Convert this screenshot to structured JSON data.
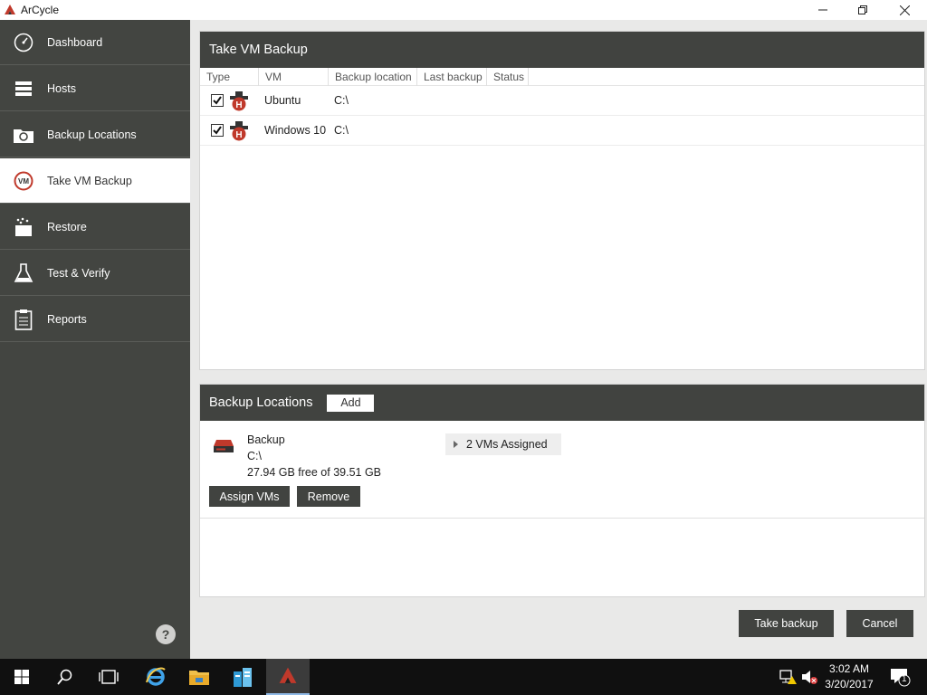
{
  "window": {
    "title": "ArCycle",
    "minimize_icon": "minimize-icon",
    "maximize_icon": "restore-icon",
    "close_icon": "close-icon"
  },
  "sidebar": {
    "items": [
      {
        "label": "Dashboard",
        "icon": "gauge-icon"
      },
      {
        "label": "Hosts",
        "icon": "server-rack-icon"
      },
      {
        "label": "Backup Locations",
        "icon": "backup-folder-icon"
      },
      {
        "label": "Take VM Backup",
        "icon": "vm-icon",
        "active": true
      },
      {
        "label": "Restore",
        "icon": "restore-box-icon"
      },
      {
        "label": "Test & Verify",
        "icon": "flask-icon"
      },
      {
        "label": "Reports",
        "icon": "clipboard-icon"
      }
    ],
    "help_label": "?"
  },
  "vm_panel": {
    "title": "Take VM Backup",
    "columns": [
      "Type",
      "VM",
      "Backup location",
      "Last backup",
      "Status"
    ],
    "rows": [
      {
        "checked": true,
        "type_icon": "hyperv-host-icon",
        "vm": "Ubuntu",
        "backup_location": "C:\\",
        "last_backup": "",
        "status": ""
      },
      {
        "checked": true,
        "type_icon": "hyperv-host-icon",
        "vm": "Windows 10",
        "backup_location": "C:\\",
        "last_backup": "",
        "status": ""
      }
    ]
  },
  "locations_panel": {
    "title": "Backup Locations",
    "add_label": "Add",
    "location": {
      "name": "Backup",
      "path": "C:\\",
      "free_space": "27.94 GB free of 39.51 GB",
      "assigned": "2 VMs Assigned",
      "assign_label": "Assign VMs",
      "remove_label": "Remove"
    }
  },
  "actions": {
    "take_backup": "Take backup",
    "cancel": "Cancel"
  },
  "taskbar": {
    "time": "3:02 AM",
    "date": "3/20/2017",
    "notification_count": "1"
  },
  "colors": {
    "sidebar_bg": "#434541",
    "header_bg": "#414340",
    "accent_red": "#c0392b"
  }
}
